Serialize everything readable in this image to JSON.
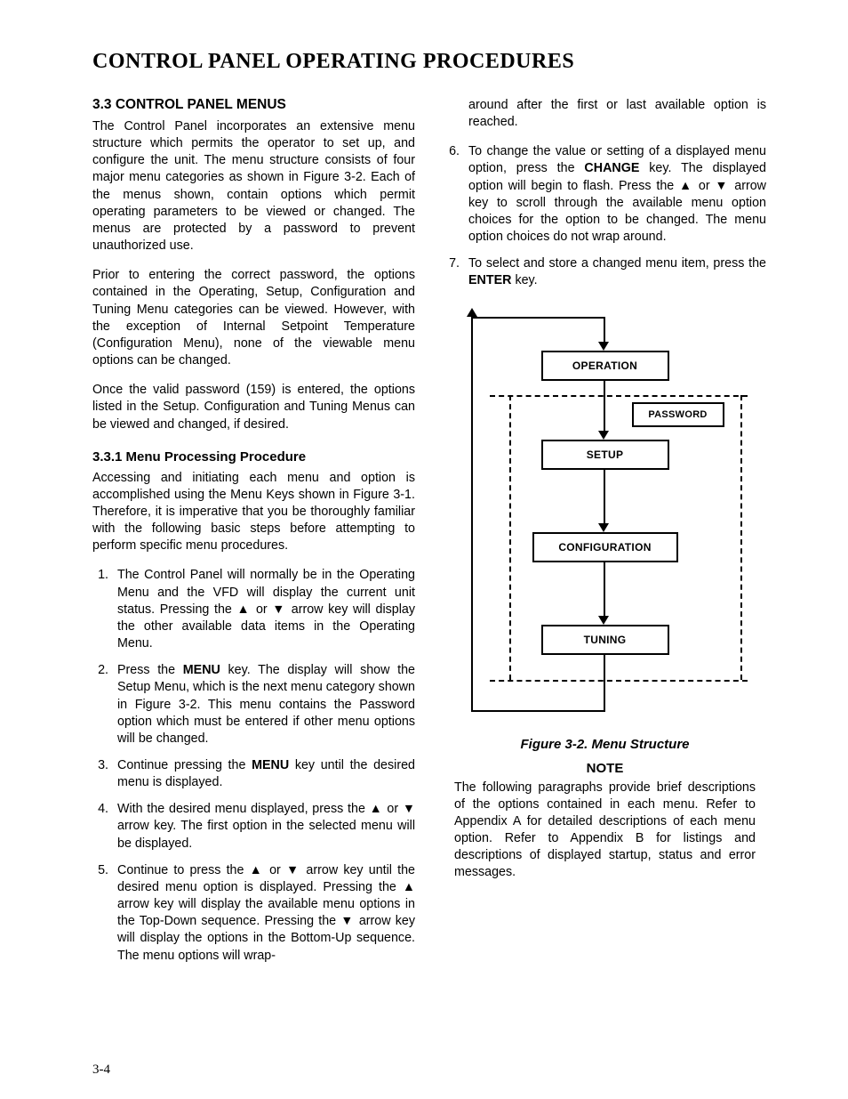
{
  "title": "CONTROL PANEL OPERATING PROCEDURES",
  "page_number": "3-4",
  "left": {
    "h2": "3.3  CONTROL PANEL MENUS",
    "p1": "The Control Panel incorporates an extensive menu structure which permits the operator to set up, and configure the unit. The menu structure consists of four major menu categories as shown in Figure 3-2.  Each of the menus shown, contain options which permit operating parameters to be viewed or changed. The menus are protected by a password to prevent unauthorized use.",
    "p2": "Prior to entering the correct password, the options contained in the Operating, Setup, Configuration and Tuning Menu categories can be viewed.  However, with the exception of Internal Setpoint Temperature (Configuration Menu), none of the viewable menu options can be changed.",
    "p3": "Once the valid password (159) is entered, the options listed in the Setup. Configuration and Tuning Menus can be viewed and changed, if desired.",
    "h3": "3.3.1   Menu Processing Procedure",
    "p4": "Accessing and initiating each menu and option is accomplished using the Menu Keys shown in Figure 3-1.  Therefore, it is imperative that you be thoroughly familiar with the following basic steps before attempting to perform specific menu procedures.",
    "li1": "The Control Panel will normally be in the Operating Menu and the VFD will display the current unit status. Pressing the ▲ or ▼ arrow key will display the other available data items in the Operating Menu.",
    "li2_a": "Press the ",
    "li2_b": "MENU",
    "li2_c": " key. The display will show the Setup Menu, which is the next menu category shown in Figure 3-2.  This menu contains the Password option which must be entered if other menu options will be changed.",
    "li3_a": "Continue pressing the ",
    "li3_b": "MENU",
    "li3_c": " key until the desired menu is displayed.",
    "li4": "With the desired menu displayed, press the ▲ or ▼ arrow key.  The first option in the selected menu will be displayed.",
    "li5": "Continue to press the ▲ or ▼ arrow key until the desired menu option is displayed. Pressing the ▲ arrow key will display the available menu options in the Top-Down sequence.  Pressing the ▼ arrow key will display the options in the Bottom-Up sequence. The menu options will wrap-"
  },
  "right": {
    "p_cont": "around after the first or last available option is reached.",
    "li6_a": "To change the value or setting of a displayed menu option, press the ",
    "li6_b": "CHANGE",
    "li6_c": " key. The displayed option will begin to flash. Press the ▲ or ▼ arrow key to scroll through the available menu option choices for the option to be changed.  The menu option choices do not wrap around.",
    "li7_a": "To select and store a changed menu item, press the ",
    "li7_b": "ENTER",
    "li7_c": " key.",
    "diagram": {
      "operation": "OPERATION",
      "password": "PASSWORD",
      "setup": "SETUP",
      "configuration": "CONFIGURATION",
      "tuning": "TUNING"
    },
    "figcap": "Figure 3-2.  Menu Structure",
    "note_head": "NOTE",
    "note_body": "The following paragraphs provide brief descriptions of the options contained in each menu.  Refer to Appendix A for detailed descriptions of each menu option.  Refer to Appendix B for listings and descriptions of displayed startup, status and error messages."
  }
}
